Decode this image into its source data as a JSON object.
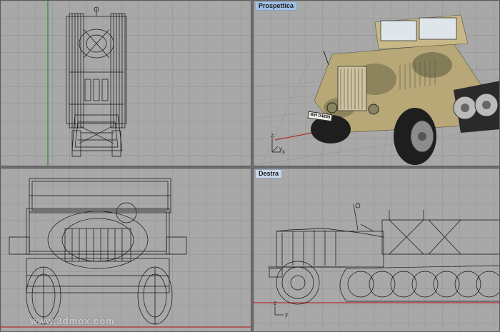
{
  "viewports": {
    "top": {
      "title": ""
    },
    "perspective": {
      "title": "Prospettica"
    },
    "front": {
      "title": ""
    },
    "right": {
      "title": "Destra"
    }
  },
  "license_plate": "WH 04859",
  "axes": {
    "perspective_x": "x",
    "perspective_y": "y",
    "perspective_z": "z",
    "right_y": "y",
    "right_z": "z"
  },
  "watermark": "www.3dmox.com",
  "colors": {
    "grid": "#a8a8a8",
    "wireframe": "#111111",
    "x_axis": "#b03030",
    "y_axis": "#2a8a2a",
    "camo_base": "#b8a878",
    "camo_dark": "#6e6a48"
  }
}
